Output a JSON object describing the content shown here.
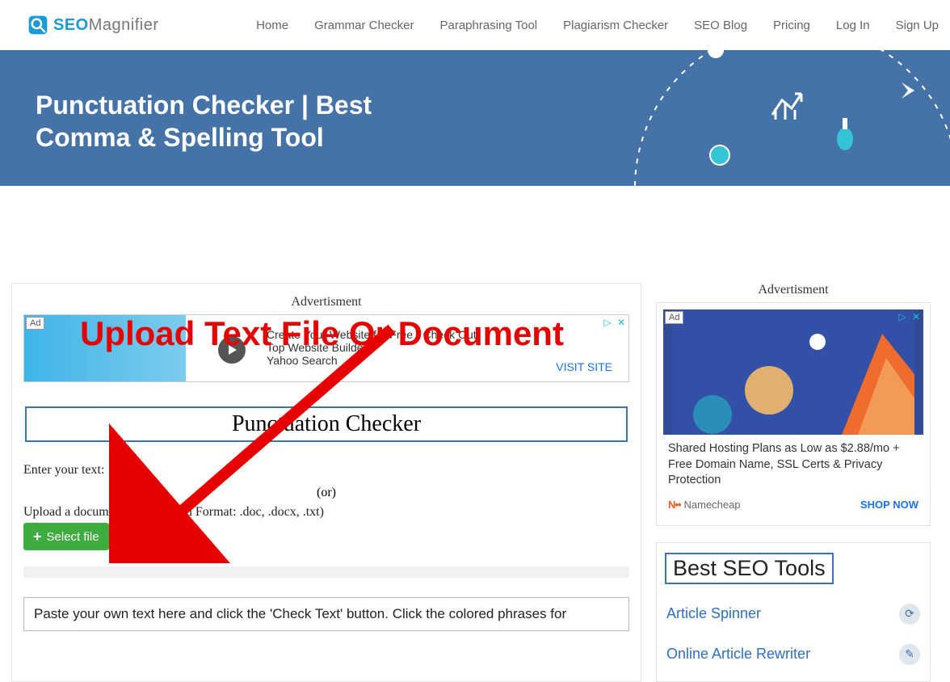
{
  "logo": {
    "seo": "SEO",
    "mag": "Magnifier"
  },
  "nav": {
    "home": "Home",
    "grammar": "Grammar Checker",
    "paraphrase": "Paraphrasing Tool",
    "plagiarism": "Plagiarism Checker",
    "blog": "SEO Blog",
    "pricing": "Pricing",
    "login": "Log In",
    "signup": "Sign Up"
  },
  "hero": {
    "title": "Punctuation Checker | Best Comma & Spelling Tool"
  },
  "overlay": {
    "text": "Upload Text File Or Document"
  },
  "main": {
    "adv_label": "Advertisment",
    "inline_ad": {
      "tag": "Ad",
      "line1": "Create Your Website for Free - Check Out Top Website Builders",
      "line2": "Yahoo Search",
      "visit": "VISIT SITE"
    },
    "tool_title": "Punctuation Checker",
    "enter_label": "Enter your text:",
    "or": "(or)",
    "upload_label": "Upload a document:  ( Supported Format: .doc, .docx, .txt)",
    "select_btn": "Select file",
    "textarea_placeholder": "Paste your own text here and click the 'Check Text' button. Click the colored phrases for"
  },
  "sidebar": {
    "adv_label": "Advertisment",
    "ad": {
      "tag": "Ad",
      "text": "Shared Hosting Plans as Low as $2.88/mo + Free Domain Name, SSL Certs & Privacy Protection",
      "brand": "Namecheap",
      "cta": "SHOP NOW"
    },
    "tools_title": "Best SEO Tools",
    "links": [
      {
        "label": "Article Spinner"
      },
      {
        "label": "Online Article Rewriter"
      }
    ]
  }
}
